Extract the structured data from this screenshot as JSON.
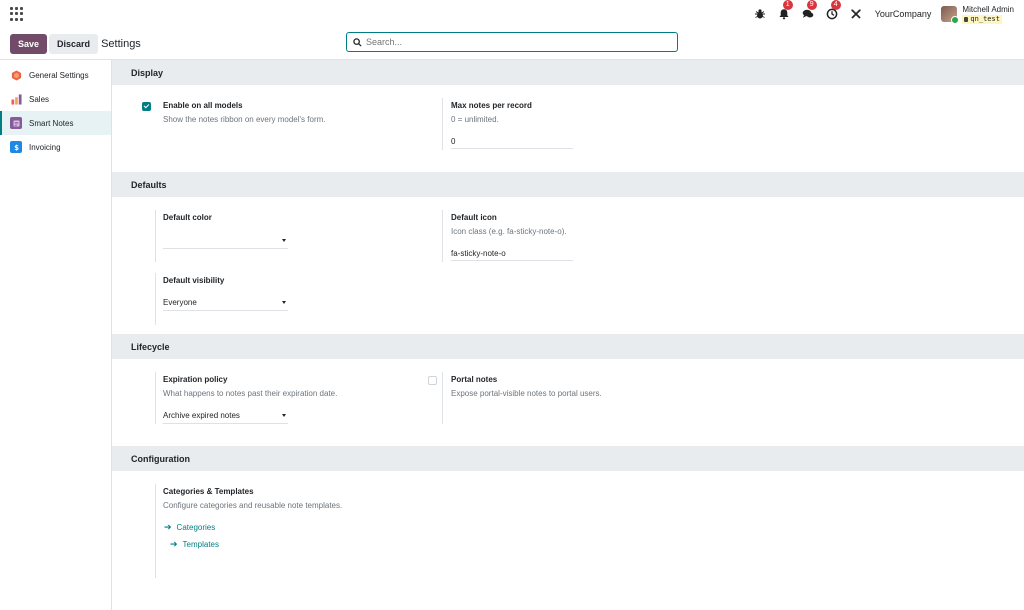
{
  "topbar": {
    "notifications": {
      "activity_count": "1",
      "messages_count": "9",
      "clock_count": "4"
    },
    "company": "YourCompany",
    "user": {
      "name": "Mitchell Admin",
      "db": "qn_test"
    }
  },
  "control": {
    "save_label": "Save",
    "discard_label": "Discard",
    "breadcrumb": "Settings",
    "search_placeholder": "Search..."
  },
  "sidebar": {
    "items": [
      {
        "label": "General Settings",
        "color": "#f06050"
      },
      {
        "label": "Sales",
        "color": "#f4a261"
      },
      {
        "label": "Smart Notes",
        "color": "#875a9a"
      },
      {
        "label": "Invoicing",
        "color": "#1e88e5"
      }
    ]
  },
  "sections": {
    "display": {
      "title": "Display",
      "enable_all": {
        "title": "Enable on all models",
        "help": "Show the notes ribbon on every model's form.",
        "checked": true
      },
      "max_notes": {
        "title": "Max notes per record",
        "help": "0 = unlimited.",
        "value": "0"
      }
    },
    "defaults": {
      "title": "Defaults",
      "color": {
        "title": "Default color",
        "value": ""
      },
      "icon": {
        "title": "Default icon",
        "help": "Icon class (e.g. fa-sticky-note-o).",
        "value": "fa-sticky-note-o"
      },
      "visibility": {
        "title": "Default visibility",
        "value": "Everyone"
      }
    },
    "lifecycle": {
      "title": "Lifecycle",
      "expiration": {
        "title": "Expiration policy",
        "help": "What happens to notes past their expiration date.",
        "value": "Archive expired notes"
      },
      "portal": {
        "title": "Portal notes",
        "help": "Expose portal-visible notes to portal users.",
        "checked": false
      }
    },
    "configuration": {
      "title": "Configuration",
      "categories": {
        "title": "Categories & Templates",
        "help": "Configure categories and reusable note templates."
      },
      "links": {
        "categories": "Categories",
        "templates": "Templates"
      }
    }
  },
  "colors": {
    "accent": "#017e84",
    "primary": "#714b67",
    "badge": "#d9363e"
  }
}
